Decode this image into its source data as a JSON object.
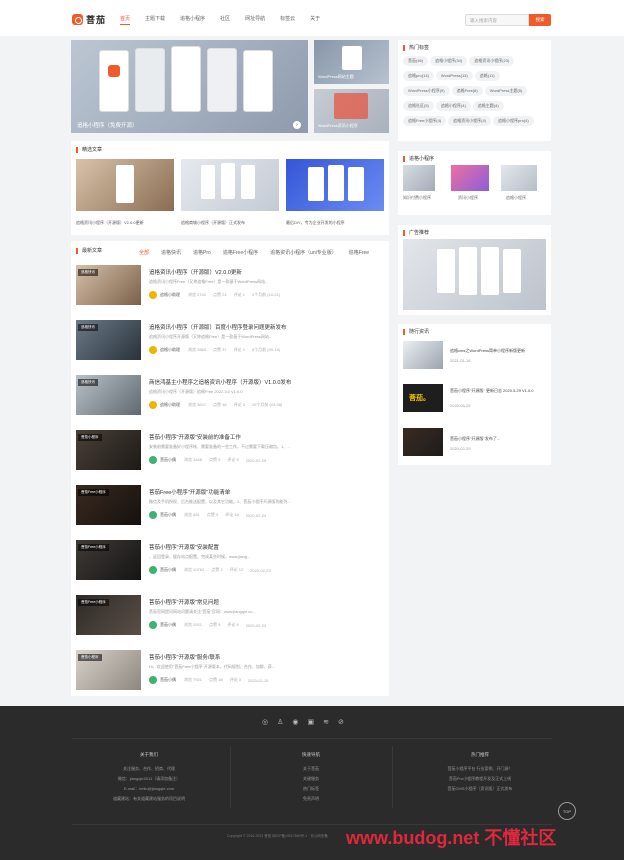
{
  "header": {
    "logo_text": "菩茄",
    "nav": [
      "首页",
      "主题下载",
      "追格小程序",
      "社区",
      "网址导航",
      "标签云",
      "关于"
    ],
    "search_placeholder": "输入搜索内容",
    "search_button": "搜索"
  },
  "banner": {
    "caption": "追格小程序（免费开源）",
    "side": [
      "WordPress网站主题",
      "WordPress资讯小程序"
    ]
  },
  "featured": {
    "title": "精选文章",
    "items": [
      "追格资讯小程序（开源版）V2.0.0更新",
      "追格商城小程序（开源版）正式发布",
      "最后DIY，专为企业开发的小程序"
    ]
  },
  "latest": {
    "title": "最新文章",
    "tabs": [
      "全部",
      "追格快讯",
      "追格Pro",
      "追格Free小程序",
      "追格资讯小程序（uni专业版）",
      "追格Free"
    ],
    "articles": [
      {
        "ribbon": "追格快讯",
        "title": "追格资讯小程序（开源版）V2.0.0更新",
        "excerpt": "追格资讯小程序Free（又称追格Free）是一款基于WordPress网站...",
        "author": "追格小助理",
        "views": "浏览 2742",
        "likes": "点赞 24",
        "comments": "评论 1",
        "date": "4个月前 (10-21)",
        "av": "#f0b400"
      },
      {
        "ribbon": "追格快讯",
        "title": "追格资讯小程序（开源版）百度小程序登录问题更新发布",
        "excerpt": "追格资讯小程序开源版（又称追格Free）是一款基于WordPress网站...",
        "author": "追格小助理",
        "views": "浏览 2883",
        "likes": "点赞 37",
        "comments": "评论 1",
        "date": "5个月前 (09-16)",
        "av": "#f0b400"
      },
      {
        "ribbon": "追格快讯",
        "title": "商信鸿基主小程序之追格资讯小程序（开源版）V1.0.0发布",
        "excerpt": "追格资讯小程序（开源版）追格Free 2022.3.0 V1.0.0",
        "author": "追格小助理",
        "views": "浏览 3637",
        "likes": "点赞 36",
        "comments": "评论 3",
        "date": "10个月前 (03-08)",
        "av": "#f0b400"
      },
      {
        "ribbon": "菩茄小程序",
        "title": "菩茄小程序\"开源版\"安装前的准备工作",
        "excerpt": "安装前需要准备好小程序帐、需要准备的一些工作，不过需要下载压缩包。1、...",
        "author": "菩茄小偶",
        "views": "浏览 3448",
        "likes": "点赞 3",
        "comments": "评论 5",
        "date": "2020-02-29",
        "av": "#3cb371"
      },
      {
        "ribbon": "菩茄Free小程序",
        "title": "菩茄Free小程序\"开源版\"功能清单",
        "excerpt": "微信及手机授权、后台推送配置、以及其它功能。1、菩茄小程序开源版功能列...",
        "author": "菩茄小偶",
        "views": "浏览 581",
        "likes": "点赞 3",
        "comments": "评论 16",
        "date": "2020-02-24",
        "av": "#3cb371"
      },
      {
        "ribbon": "菩茄Free小程序",
        "title": "菩茄小程序\"开源版\"安装配置",
        "excerpt": "、返回登录、缓存站点配置、完成某些时候，www.jiang...",
        "author": "菩茄小偶",
        "views": "浏览 10762",
        "likes": "点赞 2",
        "comments": "评论 12",
        "date": "2020-02-23",
        "av": "#3cb371"
      },
      {
        "ribbon": "菩茄Free小程序",
        "title": "菩茄小程序\"开源版\"常见问题",
        "excerpt": "菩茄官网提问网站问题请关注\"菩茄\"官网：www.jiangqie.co...",
        "author": "菩茄小偶",
        "views": "浏览 2921",
        "likes": "点赞 5",
        "comments": "评论 5",
        "date": "2020-02-23",
        "av": "#3cb371"
      },
      {
        "ribbon": "菩茄小程序",
        "title": "菩茄小程序\"开源版\"服务/联系",
        "excerpt": "Hi、欢迎使用\"菩茄Free小程序\"开源版本，代码规划、合作、加群、获...",
        "author": "菩茄小偶",
        "views": "浏览 7921",
        "likes": "点赞 18",
        "comments": "评论 3",
        "date": "2020-02-15",
        "av": "#3cb371"
      }
    ]
  },
  "sidebar": {
    "tags_title": "热门标签",
    "tags": [
      [
        "菩茄",
        "(46)"
      ],
      [
        "追格小程序",
        "(34)"
      ],
      [
        "追格资讯小程序",
        "(23)"
      ],
      [
        "追格pro",
        "(14)"
      ],
      [
        "WordPress",
        "(13)"
      ],
      [
        "追格",
        "(11)"
      ],
      [
        "WordPress小程序",
        "(9)"
      ],
      [
        "追格Free",
        "(8)"
      ],
      [
        "WordPress主题",
        "(5)"
      ],
      [
        "追格社区",
        "(5)"
      ],
      [
        "追格小程序",
        "(4)"
      ],
      [
        "追格主题",
        "(4)"
      ],
      [
        "追格Free小程序",
        "(4)"
      ],
      [
        "追格资讯小程序",
        "(4)"
      ],
      [
        "追格小程序pro",
        "(4)"
      ]
    ],
    "apps_title": "追格小程序",
    "apps": [
      "知识付费小程序",
      "资讯小程序",
      "追格小程序"
    ],
    "ad_title": "广告推荐",
    "recent_title": "随行资讯",
    "recent": [
      {
        "title": "追格cms之WordPress简单小程序新版更新",
        "date": "2021-01-16"
      },
      {
        "title": "菩茄小程序\"开源版\" 更新日志 2020.5.29 V1.0.0",
        "date": "2020-05-29"
      },
      {
        "title": "菩茄小程序\"开源版\"发布了...",
        "date": "2020-02-29"
      }
    ]
  },
  "footer": {
    "cols": [
      {
        "title": "关于我们",
        "lines": [
          "关注服务、合作、招商、代理",
          "微信：jiangqie2011（请添加备注）",
          "E-mail：hello@jiangqie.com",
          "道藏建站：有关道藏建站服务的项目说明"
        ]
      },
      {
        "title": "快速导航",
        "lines": [
          "关于菩茄",
          "关键服务",
          "热门标签",
          "免责声明"
        ]
      },
      {
        "title": "热门推荐",
        "lines": [
          "菩茄小程序平台 行业案例、开门源！",
          "菩茄Pro小程序教程开发及正式上线",
          "菩茄CMS小程序（资讯版）正式发布"
        ]
      }
    ],
    "copyright": "Copyright © 2016-2023 菩茄 网ICP备19017869号-1  · 京公网安备",
    "top": "TOP",
    "watermark": "www.budog.net 不懂社区"
  }
}
